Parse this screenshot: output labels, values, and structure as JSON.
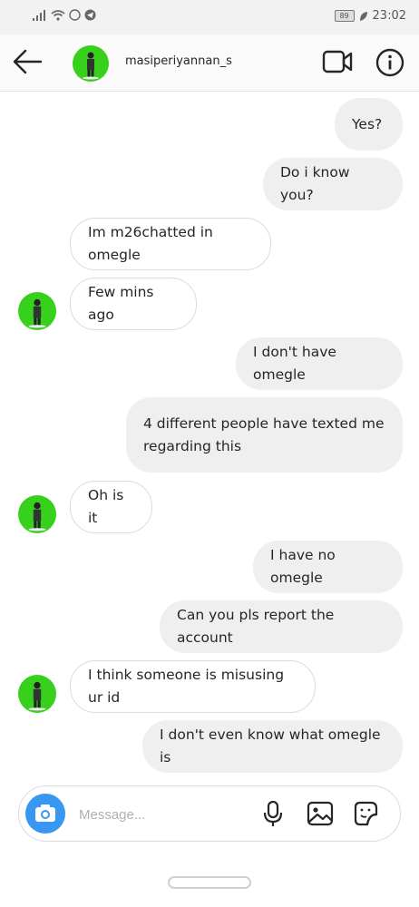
{
  "status_bar": {
    "battery": "89",
    "time": "23:02"
  },
  "header": {
    "username": "masiperiyannan_s"
  },
  "messages": [
    {
      "text": "Yes?"
    },
    {
      "text": "Do i know you?"
    },
    {
      "text": "Im m26chatted in omegle"
    },
    {
      "text": "Few mins ago"
    },
    {
      "text": "I don't have omegle"
    },
    {
      "text": "4 different people have texted me regarding this"
    },
    {
      "text": "Oh is it"
    },
    {
      "text": "I have no omegle"
    },
    {
      "text": "Can you pls report the account"
    },
    {
      "text": "I think someone is misusing ur id"
    },
    {
      "text": "I don't even know what omegle is"
    }
  ],
  "composer": {
    "placeholder": "Message..."
  }
}
